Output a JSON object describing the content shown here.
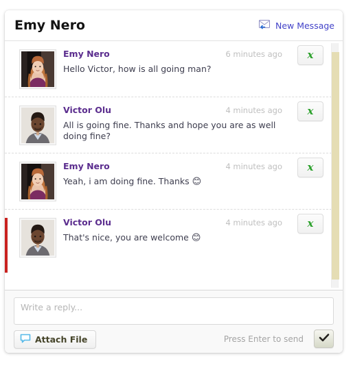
{
  "header": {
    "title": "Emy Nero",
    "new_message_label": "New Message",
    "new_message_icon": "envelope-icon",
    "new_message_color": "#4242c8"
  },
  "messages": [
    {
      "author": "Emy Nero",
      "time": "6 minutes ago",
      "text": "Hello Victor, how is all going man?",
      "emoji": "",
      "avatar": "emy-nero-avatar",
      "action_icon": "green-script-x-icon",
      "action_glyph": "х"
    },
    {
      "author": "Victor Olu",
      "time": "4 minutes ago",
      "text": "All is going fine. Thanks and hope you are as well doing fine?",
      "emoji": "",
      "avatar": "victor-olu-avatar",
      "action_icon": "green-script-x-icon",
      "action_glyph": "х"
    },
    {
      "author": "Emy Nero",
      "time": "4 minutes ago",
      "text": "Yeah, i am doing fine. Thanks ",
      "emoji": "😊",
      "avatar": "emy-nero-avatar",
      "action_icon": "green-script-x-icon",
      "action_glyph": "х"
    },
    {
      "author": "Victor Olu",
      "time": "4 minutes ago",
      "text": "That's nice, you are welcome ",
      "emoji": "😊",
      "avatar": "victor-olu-avatar",
      "action_icon": "green-script-x-icon",
      "action_glyph": "х"
    }
  ],
  "reply": {
    "placeholder": "Write a reply...",
    "value": "",
    "attach_label": "Attach File",
    "attach_icon": "speech-bubble-icon",
    "hint": "Press Enter to send",
    "send_icon": "checkmark-icon"
  },
  "colors": {
    "author": "#5b2d8e",
    "timestamp": "#bfbfbf",
    "body": "#3d3d4e",
    "scrollbar_thumb": "#e5ddb4",
    "accent_red": "#c9221f",
    "action_green": "#2aa02a"
  }
}
